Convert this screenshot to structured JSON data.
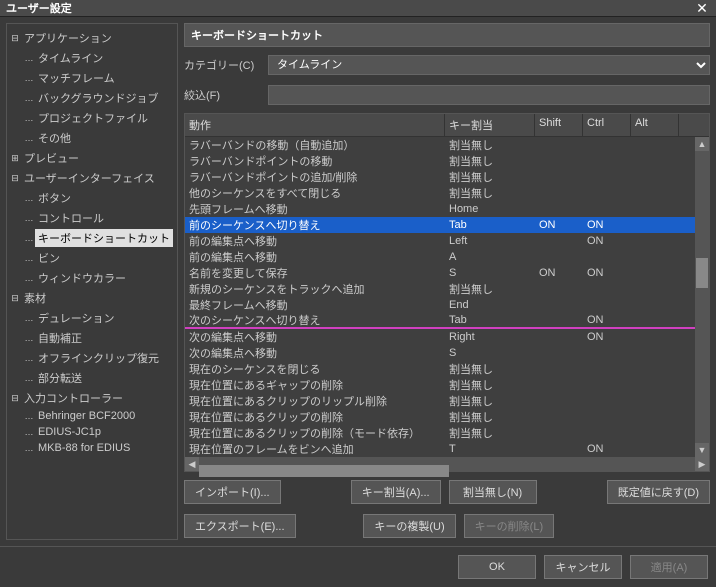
{
  "title": "ユーザー設定",
  "tree": {
    "items": [
      {
        "label": "アプリケーション",
        "expanded": true,
        "depth": 0
      },
      {
        "label": "タイムライン",
        "depth": 1
      },
      {
        "label": "マッチフレーム",
        "depth": 1
      },
      {
        "label": "バックグラウンドジョブ",
        "depth": 1
      },
      {
        "label": "プロジェクトファイル",
        "depth": 1
      },
      {
        "label": "その他",
        "depth": 1
      },
      {
        "label": "プレビュー",
        "expanded": false,
        "depth": 0
      },
      {
        "label": "ユーザーインターフェイス",
        "expanded": true,
        "depth": 0
      },
      {
        "label": "ボタン",
        "depth": 1
      },
      {
        "label": "コントロール",
        "depth": 1
      },
      {
        "label": "キーボードショートカット",
        "depth": 1,
        "selected": true
      },
      {
        "label": "ビン",
        "depth": 1
      },
      {
        "label": "ウィンドウカラー",
        "depth": 1
      },
      {
        "label": "素材",
        "expanded": true,
        "depth": 0
      },
      {
        "label": "デュレーション",
        "depth": 1
      },
      {
        "label": "自動補正",
        "depth": 1
      },
      {
        "label": "オフラインクリップ復元",
        "depth": 1
      },
      {
        "label": "部分転送",
        "depth": 1
      },
      {
        "label": "入力コントローラー",
        "expanded": true,
        "depth": 0
      },
      {
        "label": "Behringer BCF2000",
        "depth": 1
      },
      {
        "label": "EDIUS-JC1p",
        "depth": 1
      },
      {
        "label": "MKB-88 for EDIUS",
        "depth": 1
      }
    ]
  },
  "panel": {
    "title": "キーボードショートカット",
    "category_label": "カテゴリー(C)",
    "category_value": "タイムライン",
    "filter_label": "絞込(F)",
    "filter_value": ""
  },
  "grid": {
    "headers": {
      "action": "動作",
      "key": "キー割当",
      "shift": "Shift",
      "ctrl": "Ctrl",
      "alt": "Alt"
    },
    "rows": [
      {
        "action": "ラバーバンドの移動（自動追加）",
        "key": "割当無し",
        "shift": "",
        "ctrl": "",
        "alt": ""
      },
      {
        "action": "ラバーバンドポイントの移動",
        "key": "割当無し",
        "shift": "",
        "ctrl": "",
        "alt": ""
      },
      {
        "action": "ラバーバンドポイントの追加/削除",
        "key": "割当無し",
        "shift": "",
        "ctrl": "",
        "alt": ""
      },
      {
        "action": "他のシーケンスをすべて閉じる",
        "key": "割当無し",
        "shift": "",
        "ctrl": "",
        "alt": ""
      },
      {
        "action": "先頭フレームへ移動",
        "key": "Home",
        "shift": "",
        "ctrl": "",
        "alt": ""
      },
      {
        "action": "前のシーケンスへ切り替え",
        "key": "Tab",
        "shift": "ON",
        "ctrl": "ON",
        "alt": "",
        "highlight": "blue"
      },
      {
        "action": "前の編集点へ移動",
        "key": "Left",
        "shift": "",
        "ctrl": "ON",
        "alt": ""
      },
      {
        "action": "前の編集点へ移動",
        "key": "A",
        "shift": "",
        "ctrl": "",
        "alt": ""
      },
      {
        "action": "名前を変更して保存",
        "key": "S",
        "shift": "ON",
        "ctrl": "ON",
        "alt": ""
      },
      {
        "action": "新規のシーケンスをトラックへ追加",
        "key": "割当無し",
        "shift": "",
        "ctrl": "",
        "alt": ""
      },
      {
        "action": "最終フレームへ移動",
        "key": "End",
        "shift": "",
        "ctrl": "",
        "alt": ""
      },
      {
        "action": "次のシーケンスへ切り替え",
        "key": "Tab",
        "shift": "",
        "ctrl": "ON",
        "alt": "",
        "highlight": "magenta"
      },
      {
        "action": "次の編集点へ移動",
        "key": "Right",
        "shift": "",
        "ctrl": "ON",
        "alt": ""
      },
      {
        "action": "次の編集点へ移動",
        "key": "S",
        "shift": "",
        "ctrl": "",
        "alt": ""
      },
      {
        "action": "現在のシーケンスを閉じる",
        "key": "割当無し",
        "shift": "",
        "ctrl": "",
        "alt": ""
      },
      {
        "action": "現在位置にあるギャップの削除",
        "key": "割当無し",
        "shift": "",
        "ctrl": "",
        "alt": ""
      },
      {
        "action": "現在位置にあるクリップのリップル削除",
        "key": "割当無し",
        "shift": "",
        "ctrl": "",
        "alt": ""
      },
      {
        "action": "現在位置にあるクリップの削除",
        "key": "割当無し",
        "shift": "",
        "ctrl": "",
        "alt": ""
      },
      {
        "action": "現在位置にあるクリップの削除（モード依存）",
        "key": "割当無し",
        "shift": "",
        "ctrl": "",
        "alt": ""
      },
      {
        "action": "現在位置のフレームをビンへ追加",
        "key": "T",
        "shift": "",
        "ctrl": "ON",
        "alt": ""
      }
    ]
  },
  "buttons": {
    "import": "インポート(I)...",
    "export": "エクスポート(E)...",
    "assign": "キー割当(A)...",
    "unassign": "割当無し(N)",
    "defaults": "既定値に戻す(D)",
    "duplicate": "キーの複製(U)",
    "delete": "キーの削除(L)",
    "ok": "OK",
    "cancel": "キャンセル",
    "apply": "適用(A)"
  }
}
